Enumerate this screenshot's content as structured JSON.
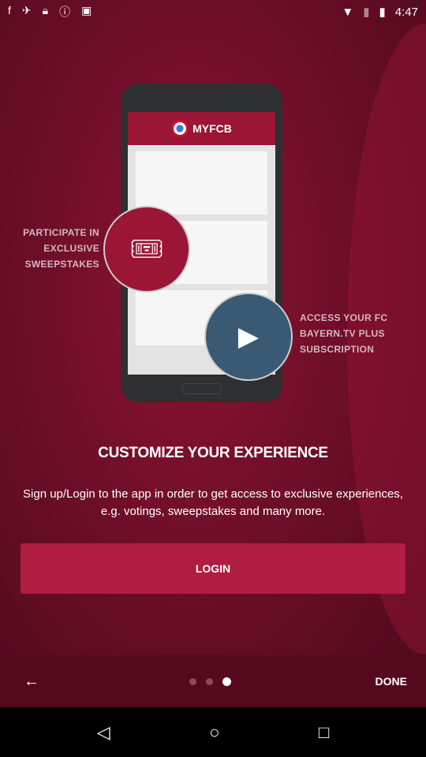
{
  "status": {
    "time": "4:47",
    "icons": [
      "facebook-icon",
      "satellite-icon",
      "lock-icon",
      "alert-icon",
      "android-icon",
      "wifi-icon",
      "no-sim-icon",
      "battery-icon"
    ]
  },
  "illustration": {
    "app_title": "MYFCB",
    "left_caption": "PARTICIPATE IN EXCLUSIVE SWEEPSTAKES",
    "right_caption": "ACCESS YOUR FC BAYERN.TV PLUS SUBSCRIPTION"
  },
  "main": {
    "title": "CUSTOMIZE YOUR EXPERIENCE",
    "description": "Sign up/Login to the app in order to get access to exclusive experiences, e.g. votings, sweepstakes and many more.",
    "login_label": "LOGIN"
  },
  "pager": {
    "done_label": "DONE",
    "page": 3,
    "pages": 3
  },
  "colors": {
    "brand": "#9b1535",
    "button": "#b01c42",
    "tv": "#3a5a73"
  }
}
